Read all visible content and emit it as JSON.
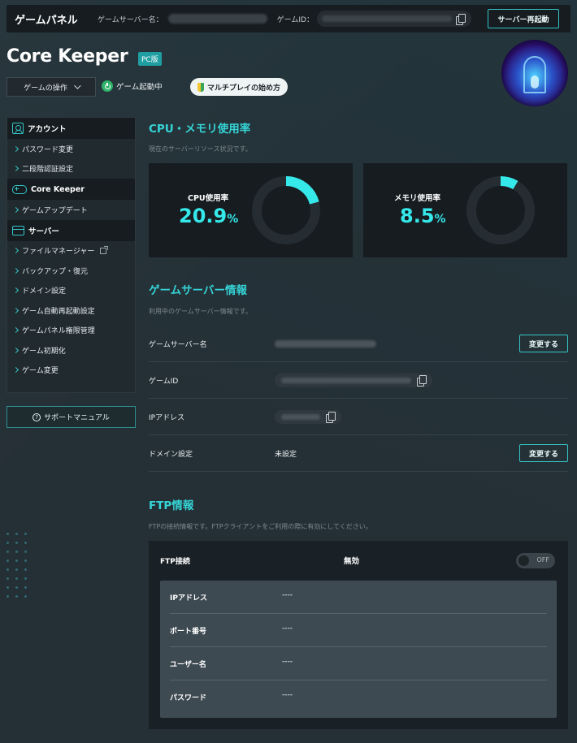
{
  "topbar": {
    "brand": "ゲームパネル",
    "server_name_label": "ゲームサーバー名：",
    "game_id_label": "ゲームID：",
    "restart_label": "サーバー再起動"
  },
  "header": {
    "game_title": "Core Keeper",
    "platform_badge": "PC版",
    "operation_select": "ゲームの操作",
    "status": "ゲーム起動中",
    "multiplay_button": "マルチプレイの始め方"
  },
  "sidebar": {
    "sections": [
      {
        "title": "アカウント",
        "icon": "user-icon",
        "items": [
          "パスワード変更",
          "二段階認証設定"
        ]
      },
      {
        "title": "Core Keeper",
        "icon": "gamepad-icon",
        "items": [
          "ゲームアップデート"
        ]
      },
      {
        "title": "サーバー",
        "icon": "server-icon",
        "items": [
          "ファイルマネージャー",
          "バックアップ・復元",
          "ドメイン設定",
          "ゲーム自動再起動設定",
          "ゲームパネル権限管理",
          "ゲーム初期化",
          "ゲーム変更"
        ]
      }
    ],
    "support": "サポートマニュアル"
  },
  "usage": {
    "title": "CPU・メモリ使用率",
    "subtitle": "現在のサーバーリソース状況です。",
    "cpu": {
      "label": "CPU使用率",
      "value": "20.9",
      "unit": "%",
      "fraction": 0.209
    },
    "memory": {
      "label": "メモリ使用率",
      "value": "8.5",
      "unit": "%",
      "fraction": 0.085
    },
    "accent": "#35e8ea"
  },
  "server_info": {
    "title": "ゲームサーバー情報",
    "subtitle": "利用中のゲームサーバー情報です。",
    "rows": {
      "name": {
        "label": "ゲームサーバー名",
        "button": "変更する"
      },
      "id": {
        "label": "ゲームID"
      },
      "ip": {
        "label": "IPアドレス"
      },
      "domain": {
        "label": "ドメイン設定",
        "value": "未設定",
        "button": "変更する"
      }
    }
  },
  "ftp": {
    "title": "FTP情報",
    "subtitle": "FTPの接続情報です。FTPクライアントをご利用の際に有効にしてください。",
    "connection_label": "FTP接続",
    "connection_state": "無効",
    "toggle_label": "OFF",
    "details": [
      {
        "label": "IPアドレス",
        "value": "----"
      },
      {
        "label": "ポート番号",
        "value": "----"
      },
      {
        "label": "ユーザー名",
        "value": "----"
      },
      {
        "label": "パスワード",
        "value": "----"
      }
    ]
  }
}
